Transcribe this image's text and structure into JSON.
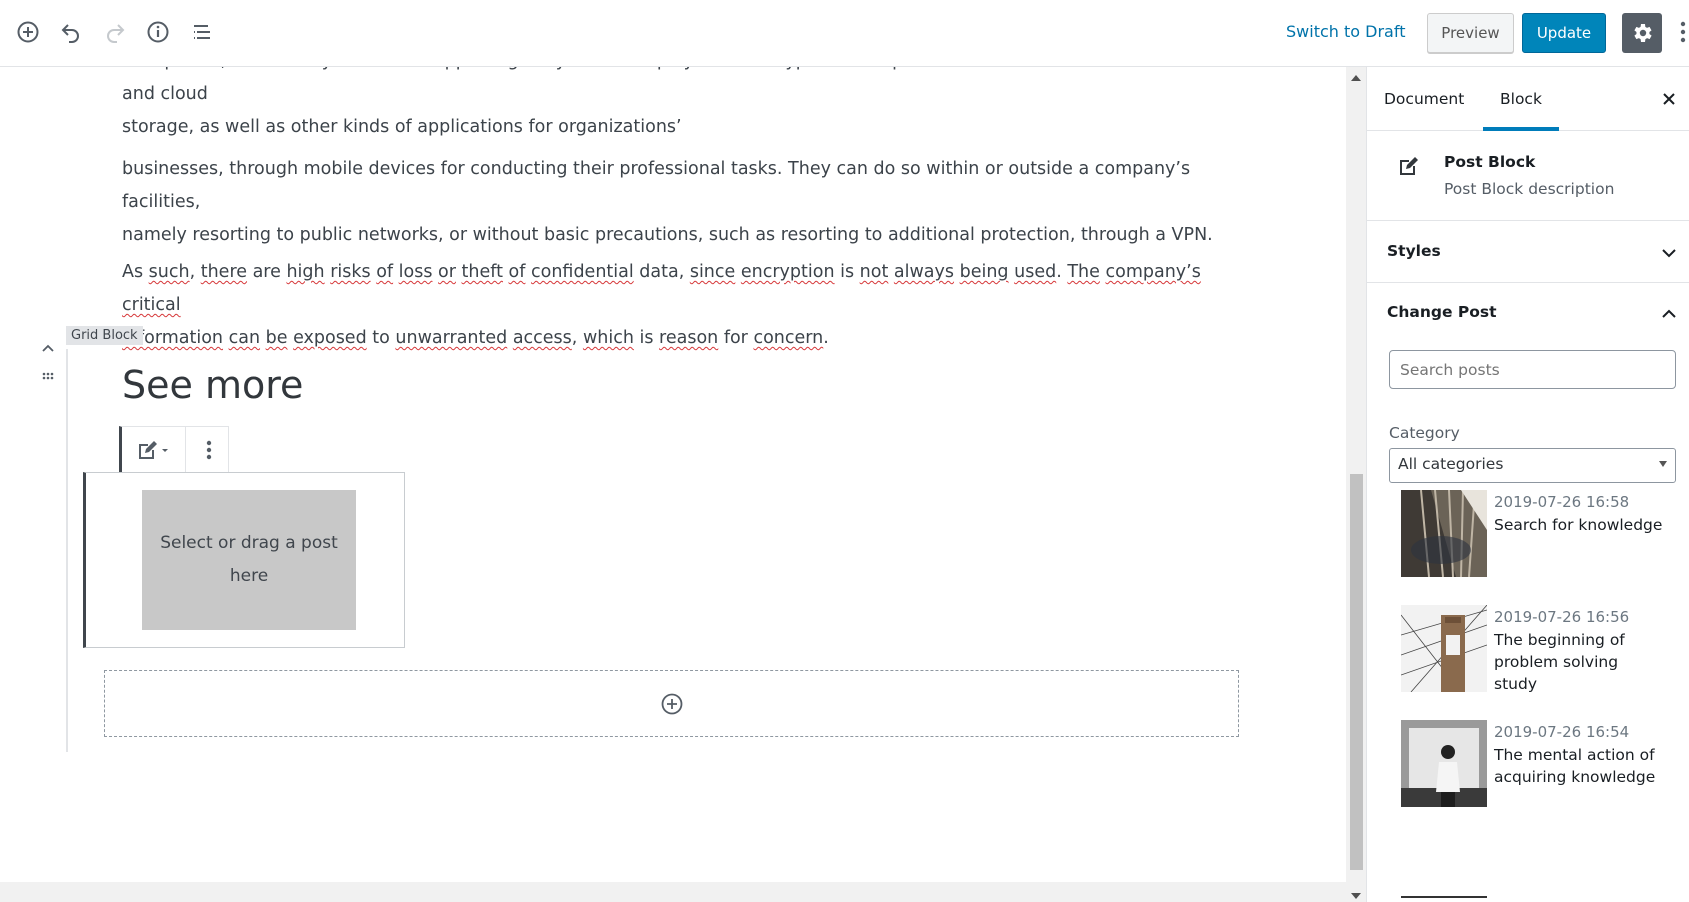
{
  "toolbar": {
    "add_block_icon": "plus-circle-icon",
    "undo_icon": "undo-icon",
    "redo_icon": "redo-icon",
    "info_icon": "info-icon",
    "outline_icon": "list-outline-icon",
    "switch_draft_label": "Switch to Draft",
    "preview_label": "Preview",
    "update_label": "Update",
    "settings_icon": "gear-icon",
    "more_icon": "more-vertical-icon",
    "accent": "#0085ba"
  },
  "content": {
    "para1": "workplaces, as auxiliary means of supporting daily tasks. Employees of all types of companies use resources such as email and cloud",
    "para1b": "storage, as well as other kinds of applications for organizations’",
    "para2a": "businesses, through mobile devices for conducting their professional tasks. They can do so within or outside a company’s facilities,",
    "para2b": "namely resorting to public networks, or without basic precautions, such as resorting to additional protection, through a VPN.",
    "para3": [
      {
        "t": "As ",
        "s": false
      },
      {
        "t": "such",
        "s": true
      },
      {
        "t": ", ",
        "s": false
      },
      {
        "t": "there",
        "s": true
      },
      {
        "t": " are ",
        "s": false
      },
      {
        "t": "high",
        "s": true
      },
      {
        "t": " ",
        "s": false
      },
      {
        "t": "risks",
        "s": true
      },
      {
        "t": " ",
        "s": false
      },
      {
        "t": "of",
        "s": true
      },
      {
        "t": " ",
        "s": false
      },
      {
        "t": "loss",
        "s": true
      },
      {
        "t": " ",
        "s": false
      },
      {
        "t": "or",
        "s": true
      },
      {
        "t": " ",
        "s": false
      },
      {
        "t": "theft",
        "s": true
      },
      {
        "t": " ",
        "s": false
      },
      {
        "t": "of",
        "s": true
      },
      {
        "t": " ",
        "s": false
      },
      {
        "t": "confidential",
        "s": true
      },
      {
        "t": " data, ",
        "s": false
      },
      {
        "t": "since",
        "s": true
      },
      {
        "t": " ",
        "s": false
      },
      {
        "t": "encryption",
        "s": true
      },
      {
        "t": " is ",
        "s": false
      },
      {
        "t": "not",
        "s": true
      },
      {
        "t": " ",
        "s": false
      },
      {
        "t": "always",
        "s": true
      },
      {
        "t": " ",
        "s": false
      },
      {
        "t": "being",
        "s": true
      },
      {
        "t": " ",
        "s": false
      },
      {
        "t": "used",
        "s": true
      },
      {
        "t": ". ",
        "s": false
      },
      {
        "t": "The",
        "s": true
      },
      {
        "t": " ",
        "s": false
      },
      {
        "t": "company’s",
        "s": true
      },
      {
        "t": " ",
        "s": false
      },
      {
        "t": "critical",
        "s": true
      }
    ],
    "para3b": [
      {
        "t": "information",
        "s": true
      },
      {
        "t": " ",
        "s": false
      },
      {
        "t": "can",
        "s": true
      },
      {
        "t": " ",
        "s": false
      },
      {
        "t": "be",
        "s": true
      },
      {
        "t": " ",
        "s": false
      },
      {
        "t": "exposed",
        "s": true
      },
      {
        "t": " to ",
        "s": false
      },
      {
        "t": "unwarranted",
        "s": true
      },
      {
        "t": " ",
        "s": false
      },
      {
        "t": "access",
        "s": true
      },
      {
        "t": ", ",
        "s": false
      },
      {
        "t": "which",
        "s": true
      },
      {
        "t": " is ",
        "s": false
      },
      {
        "t": "reason",
        "s": true
      },
      {
        "t": " for ",
        "s": false
      },
      {
        "t": "concern",
        "s": true
      },
      {
        "t": ".",
        "s": false
      }
    ],
    "grid_label": "Grid Block",
    "heading": "See more",
    "post_slot_text": "Select or drag a post here",
    "appender_icon": "plus-circle-icon"
  },
  "sidebar": {
    "tabs": [
      "Document",
      "Block"
    ],
    "active_tab": "Block",
    "close_icon": "close-icon",
    "block": {
      "title": "Post Block",
      "description": "Post Block description",
      "icon": "edit-post-icon"
    },
    "panels": {
      "styles": "Styles",
      "change_post": "Change Post"
    },
    "search_placeholder": "Search posts",
    "category_label": "Category",
    "category_value": "All categories",
    "posts": [
      {
        "date": "2019-07-26 16:58",
        "title": "Search for knowledge"
      },
      {
        "date": "2019-07-26 16:56",
        "title": "The beginning of problem solving study"
      },
      {
        "date": "2019-07-26 16:54",
        "title": "The mental action of acquiring knowledge"
      }
    ]
  }
}
